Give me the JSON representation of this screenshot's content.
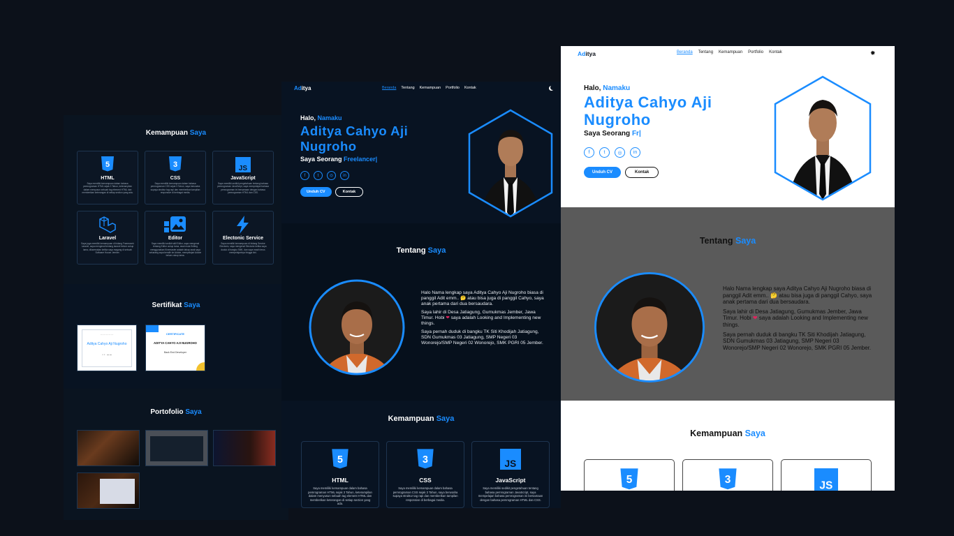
{
  "colors": {
    "accent": "#1a8cff",
    "dark_bg": "#081322",
    "page_bg": "#0c111a",
    "about_gray": "#5a5a5a"
  },
  "brand": {
    "logo_part1": "Ad",
    "logo_part2": "itya"
  },
  "nav": {
    "items": [
      "Beranda",
      "Tentang",
      "Kemampuan",
      "Portfolio",
      "Kontak"
    ],
    "active": "Beranda",
    "theme_icon_dark": "moon-icon",
    "theme_icon_light": "sun-icon"
  },
  "hero": {
    "hello": "Halo,",
    "hello_highlight": "Namaku",
    "name_line1": "Aditya Cahyo Aji",
    "name_line2": "Nugroho",
    "role_prefix": "Saya Seorang",
    "role_typed_mid": "Freelancer|",
    "role_typed_right": "Fr|",
    "socials": [
      "facebook-icon",
      "twitter-icon",
      "instagram-icon",
      "linkedin-icon"
    ],
    "cv_button": "Unduh CV",
    "contact_button": "Kontak"
  },
  "about": {
    "title": "Tentang",
    "title_highlight": "Saya",
    "p1": "Halo Nama lengkap saya Aditya Cahyo Aji Nugroho biasa di panggil Adit emm.. 🤔 atau bisa juga di panggil Cahyo, saya anak pertama dari dua bersaudara.",
    "p2_before": "Saya lahir di Desa Jatiagung, Gumukmas Jember, Jawa Timur. Hobi",
    "p2_after": "saya adalah Looking and Implementing new things.",
    "p3": "Saya pernah duduk di bangku TK Siti Khodijah Jatiagung, SDN Gumukmas 03 Jatiagung, SMP Negeri 03 Wonorejo/SMP Negeri 02 Wonorejo, SMK PGRI 05 Jember."
  },
  "skills": {
    "title": "Kemampuan",
    "title_highlight": "Saya",
    "items": [
      {
        "name": "HTML",
        "icon": "html5-icon",
        "desc": "Saya memiliki kemampuan dalam bahasa pemrograman HTML sejak 3 Tahun, keterampilan dalam menyusun sebuah tag element HTML dan memberikan keterangan di setiap section yang ada."
      },
      {
        "name": "CSS",
        "icon": "css3-icon",
        "desc": "Saya memiliki kemampuan dalam bahasa pemrograman CSS sejak 3 Tahun, saya berusaha supaya struktur tag rapi dan memberikan tampilan responsive di berbagai media."
      },
      {
        "name": "JavaScript",
        "icon": "javascript-icon",
        "desc": "Saya memiliki sedikit pengetahuan tentang bahasa pemrograman JavaScript, saya mempelajari bahasa pemrograman ini bersamaan dengan bahasa pemrograman HTML dan CSS."
      },
      {
        "name": "Laravel",
        "icon": "laravel-icon",
        "desc": "Saya juga memiliki kemampuan di bidang Framework Laravel, saya mengenal tentang laravel belum cukup lama, dikarenakan ketika saya magang di sebuah Software House Jember."
      },
      {
        "name": "Editor",
        "icon": "image-editor-icon",
        "desc": "Saya memiliki sedikit skill Editor, saya mengenal tentang Editor cukup lama, awal mula Editing menggunakan Kinemaster adalah tahap awal saya sekarang saya beralih ke Adobe, mempelajari Adobe belum cukup lama."
      },
      {
        "name": "Electonic Service",
        "icon": "lightning-icon",
        "desc": "Saya memiliki kemampuan di bidang Service Electonic, saya mengenal Electonic ketika saya duduk di bangku SMK, dan saya masih terus mempelajarinya hingga kini."
      }
    ]
  },
  "certificates": {
    "title": "Sertifikat",
    "title_highlight": "Saya",
    "items": [
      {
        "caption": "Aditya Cahyo Aji Nugroho"
      },
      {
        "heading": "CERTIFICATE",
        "caption": "ADITYA CAHYO AJI NUGROHO",
        "sub": "Back End Developer"
      }
    ]
  },
  "portfolio": {
    "title": "Portofolio",
    "title_highlight": "Saya",
    "items": [
      "portfolio-thumb-1",
      "portfolio-thumb-2",
      "portfolio-thumb-3",
      "portfolio-thumb-4"
    ]
  }
}
